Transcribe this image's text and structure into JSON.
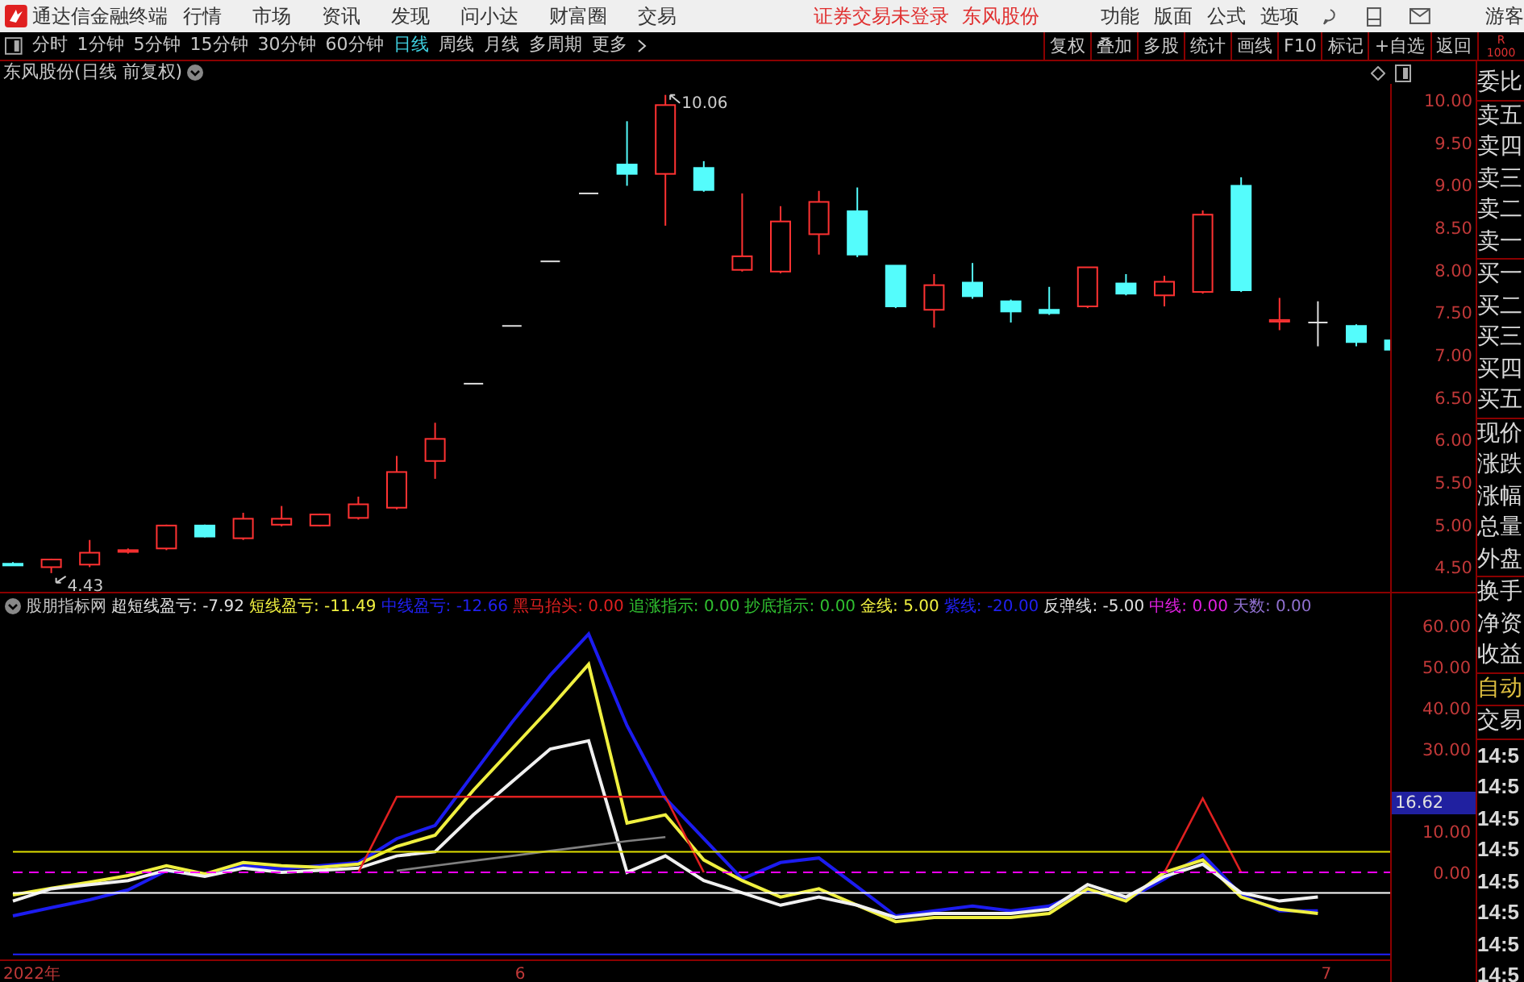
{
  "app": {
    "title": "通达信金融终端",
    "menu": [
      "行情",
      "市场",
      "资讯",
      "发现",
      "问小达",
      "财富圈",
      "交易"
    ],
    "notices": [
      "证券交易未登录",
      "东风股份"
    ],
    "right_menu": [
      "功能",
      "版面",
      "公式",
      "选项"
    ],
    "user": "游客"
  },
  "periods": [
    {
      "label": "分时",
      "selected": false
    },
    {
      "label": "1分钟",
      "selected": false
    },
    {
      "label": "5分钟",
      "selected": false
    },
    {
      "label": "15分钟",
      "selected": false
    },
    {
      "label": "30分钟",
      "selected": false
    },
    {
      "label": "60分钟",
      "selected": false
    },
    {
      "label": "日线",
      "selected": true
    },
    {
      "label": "周线",
      "selected": false
    },
    {
      "label": "月线",
      "selected": false
    },
    {
      "label": "多周期",
      "selected": false
    },
    {
      "label": "更多",
      "selected": false
    }
  ],
  "tools": [
    "复权",
    "叠加",
    "多股",
    "统计",
    "画线",
    "F10",
    "标记",
    "+自选",
    "返回"
  ],
  "corner": [
    "R",
    "1000"
  ],
  "chart_title": "东风股份(日线 前复权)",
  "price_panel": {
    "chart_data": {
      "type": "candlestick",
      "ylim": [
        4.21,
        10.19
      ],
      "yticks": [
        {
          "value": 10,
          "label": "10.00"
        },
        {
          "value": 9.5,
          "label": "9.50"
        },
        {
          "value": 9,
          "label": "9.00"
        },
        {
          "value": 8.5,
          "label": "8.50"
        },
        {
          "value": 8,
          "label": "8.00"
        },
        {
          "value": 7.5,
          "label": "7.50"
        },
        {
          "value": 7,
          "label": "7.00"
        },
        {
          "value": 6.5,
          "label": "6.50"
        },
        {
          "value": 6,
          "label": "6.00"
        },
        {
          "value": 5.5,
          "label": "5.50"
        },
        {
          "value": 5,
          "label": "5.00"
        },
        {
          "value": 4.5,
          "label": "4.50"
        }
      ],
      "ohlc": [
        [
          4.54,
          4.56,
          4.52,
          4.52
        ],
        [
          4.5,
          4.6,
          4.43,
          4.59
        ],
        [
          4.53,
          4.82,
          4.5,
          4.67
        ],
        [
          4.68,
          4.72,
          4.66,
          4.7
        ],
        [
          4.72,
          5.0,
          4.7,
          4.99
        ],
        [
          4.99,
          5.0,
          4.85,
          4.86
        ],
        [
          4.84,
          5.14,
          4.82,
          5.07
        ],
        [
          5.0,
          5.22,
          4.98,
          5.07
        ],
        [
          4.99,
          5.13,
          4.98,
          5.12
        ],
        [
          5.08,
          5.33,
          5.06,
          5.24
        ],
        [
          5.2,
          5.81,
          5.18,
          5.62
        ],
        [
          5.75,
          6.2,
          5.54,
          6.01
        ],
        [
          6.66,
          6.66,
          6.66,
          6.66
        ],
        [
          7.34,
          7.34,
          7.34,
          7.34
        ],
        [
          8.1,
          8.1,
          8.1,
          8.1
        ],
        [
          8.9,
          8.9,
          8.9,
          8.9
        ],
        [
          9.24,
          9.75,
          8.99,
          9.13
        ],
        [
          9.13,
          10.06,
          8.52,
          9.94
        ],
        [
          9.2,
          9.28,
          8.92,
          8.94
        ],
        [
          8.0,
          8.9,
          7.98,
          8.16
        ],
        [
          7.98,
          8.75,
          7.96,
          8.57
        ],
        [
          8.42,
          8.93,
          8.18,
          8.8
        ],
        [
          8.69,
          8.97,
          8.15,
          8.18
        ],
        [
          8.05,
          8.05,
          7.55,
          7.57
        ],
        [
          7.53,
          7.95,
          7.32,
          7.82
        ],
        [
          7.85,
          8.08,
          7.66,
          7.69
        ],
        [
          7.63,
          7.65,
          7.38,
          7.51
        ],
        [
          7.53,
          7.8,
          7.47,
          7.49
        ],
        [
          7.57,
          8.03,
          7.55,
          8.03
        ],
        [
          7.84,
          7.95,
          7.7,
          7.72
        ],
        [
          7.7,
          7.93,
          7.57,
          7.86
        ],
        [
          7.74,
          8.7,
          7.72,
          8.65
        ],
        [
          8.99,
          9.09,
          7.74,
          7.76
        ],
        [
          7.39,
          7.67,
          7.29,
          7.41
        ],
        [
          7.38,
          7.63,
          7.1,
          7.38
        ],
        [
          7.34,
          7.36,
          7.1,
          7.15
        ],
        [
          7.17,
          7.2,
          7.04,
          7.06
        ]
      ],
      "annotations": [
        "10.06",
        "4.43"
      ]
    }
  },
  "indicator": {
    "name": "股朋指标网",
    "items": [
      {
        "label": "超短线盈亏:",
        "value": "-7.92",
        "color": "#e0e0e0"
      },
      {
        "label": "短线盈亏:",
        "value": "-11.49",
        "color": "#f0f040"
      },
      {
        "label": "中线盈亏:",
        "value": "-12.66",
        "color": "#2020f0"
      },
      {
        "label": "黑马抬头:",
        "value": "0.00",
        "color": "#e02020"
      },
      {
        "label": "追涨指示:",
        "value": "0.00",
        "color": "#30c030"
      },
      {
        "label": "抄底指示:",
        "value": "0.00",
        "color": "#30c030"
      },
      {
        "label": "金线:",
        "value": "5.00",
        "color": "#f0f040"
      },
      {
        "label": "紫线:",
        "value": "-20.00",
        "color": "#2020f0"
      },
      {
        "label": "反弹线:",
        "value": "-5.00",
        "color": "#e0e0e0"
      },
      {
        "label": "中线:",
        "value": "0.00",
        "color": "#e020e0"
      },
      {
        "label": "天数:",
        "value": "0.00",
        "color": "#9070d0"
      }
    ],
    "cursor_value": "16.62",
    "chart_data": {
      "type": "line",
      "ylim": [
        -21.2,
        61.6
      ],
      "yticks": [
        {
          "value": 60,
          "label": "60.00"
        },
        {
          "value": 50,
          "label": "50.00"
        },
        {
          "value": 40,
          "label": "40.00"
        },
        {
          "value": 30,
          "label": "30.00"
        },
        {
          "value": 10,
          "label": "10.00"
        },
        {
          "value": 0,
          "label": "0.00"
        }
      ],
      "series": [
        {
          "color": "#1c1cf0",
          "values": [
            -10.6,
            -8.6,
            -6.7,
            -4.3,
            0.4,
            -0.8,
            1.6,
            0.8,
            1.6,
            2.4,
            8.2,
            11.4,
            24,
            36.5,
            48,
            58,
            35.7,
            18,
            8.2,
            -1.6,
            2.4,
            3.5,
            -3.5,
            -10.6,
            -9.4,
            -8.2,
            -9.4,
            -8.2,
            -4.3,
            -6.7,
            -1.6,
            4.3,
            -5.5,
            -9.4,
            -9.4,
            null,
            null
          ]
        },
        {
          "color": "#f0f040",
          "values": [
            -5.5,
            -3.9,
            -2.4,
            -0.8,
            1.6,
            -0.4,
            2.4,
            1.6,
            1.2,
            2.0,
            6.3,
            9.0,
            20,
            30,
            40,
            50.6,
            12,
            14,
            3,
            -2,
            -6,
            -4,
            -8,
            -12,
            -11,
            -11,
            -11,
            -10,
            -4,
            -7,
            0,
            3,
            -6,
            -9,
            -10,
            null,
            null
          ]
        },
        {
          "color": "#f0f0f0",
          "values": [
            -7,
            -4,
            -3,
            -2,
            0.5,
            -1,
            1,
            0,
            0.5,
            1,
            4,
            5,
            14,
            22,
            30,
            32,
            0,
            4,
            -2,
            -5,
            -8,
            -6,
            -8,
            -11,
            -10,
            -10,
            -10,
            -9,
            -3,
            -6,
            -1,
            2,
            -5,
            -7,
            -6,
            null,
            null
          ]
        },
        {
          "color": "#e02020",
          "values": [
            null,
            null,
            null,
            null,
            null,
            null,
            null,
            null,
            null,
            0,
            18.4,
            18.4,
            18.4,
            18.4,
            18.4,
            18.4,
            18.4,
            18.4,
            0,
            null,
            null,
            null,
            null,
            null,
            null,
            null,
            null,
            null,
            null,
            null,
            0,
            18,
            0,
            null,
            null,
            null,
            null
          ]
        },
        {
          "color": "#808080",
          "values": [
            null,
            null,
            null,
            null,
            null,
            null,
            null,
            null,
            null,
            null,
            0.4,
            1.6,
            2.8,
            4,
            5.2,
            6.4,
            7.6,
            8.6,
            null,
            null,
            null,
            null,
            null,
            null,
            null,
            null,
            null,
            null,
            null,
            null,
            null,
            null,
            null,
            null,
            null,
            null,
            null
          ]
        },
        {
          "color": "#e0e000",
          "values": [
            5,
            5,
            5,
            5,
            5,
            5,
            5,
            5,
            5,
            5,
            5,
            5,
            5,
            5,
            5,
            5,
            5,
            5,
            5,
            5,
            5,
            5,
            5,
            5,
            5,
            5,
            5,
            5,
            5,
            5,
            5,
            5,
            5,
            5,
            5,
            5,
            5
          ]
        },
        {
          "color": "#ff00ff",
          "line_style": "dashed",
          "values": [
            0,
            0,
            0,
            0,
            0,
            0,
            0,
            0,
            0,
            0,
            0,
            0,
            0,
            0,
            0,
            0,
            0,
            0,
            0,
            0,
            0,
            0,
            0,
            0,
            0,
            0,
            0,
            0,
            0,
            0,
            0,
            0,
            0,
            0,
            0,
            0,
            0
          ]
        },
        {
          "color": "#ffffff",
          "values": [
            -5,
            -5,
            -5,
            -5,
            -5,
            -5,
            -5,
            -5,
            -5,
            -5,
            -5,
            -5,
            -5,
            -5,
            -5,
            -5,
            -5,
            -5,
            -5,
            -5,
            -5,
            -5,
            -5,
            -5,
            -5,
            -5,
            -5,
            -5,
            -5,
            -5,
            -5,
            -5,
            -5,
            -5,
            -5,
            -5,
            -5
          ]
        },
        {
          "color": "#2020ff",
          "values": [
            -20,
            -20,
            -20,
            -20,
            -20,
            -20,
            -20,
            -20,
            -20,
            -20,
            -20,
            -20,
            -20,
            -20,
            -20,
            -20,
            -20,
            -20,
            -20,
            -20,
            -20,
            -20,
            -20,
            -20,
            -20,
            -20,
            -20,
            -20,
            -20,
            -20,
            -20,
            -20,
            -20,
            -20,
            -20,
            -20,
            -20
          ]
        }
      ]
    }
  },
  "date_axis": [
    "2022年",
    "6",
    "7"
  ],
  "sidebar": [
    {
      "kind": "label",
      "highlight": false,
      "items": [
        "委比"
      ]
    },
    {
      "kind": "label",
      "highlight": false,
      "items": [
        "卖五",
        "卖四",
        "卖三",
        "卖二",
        "卖一"
      ]
    },
    {
      "kind": "label",
      "highlight": false,
      "items": [
        "买一",
        "买二",
        "买三",
        "买四",
        "买五"
      ]
    },
    {
      "kind": "label",
      "highlight": false,
      "items": [
        "现价",
        "涨跌",
        "涨幅",
        "总量",
        "外盘"
      ]
    },
    {
      "kind": "label",
      "highlight": false,
      "items": [
        "换手",
        "净资",
        "收益"
      ]
    },
    {
      "kind": "label",
      "highlight": true,
      "items": [
        "自动"
      ]
    },
    {
      "kind": "label",
      "highlight": false,
      "items": [
        "交易"
      ]
    },
    {
      "kind": "time",
      "highlight": false,
      "items": [
        "14:5",
        "14:5",
        "14:5",
        "14:5",
        "14:5",
        "14:5",
        "14:5",
        "14:5"
      ]
    }
  ]
}
